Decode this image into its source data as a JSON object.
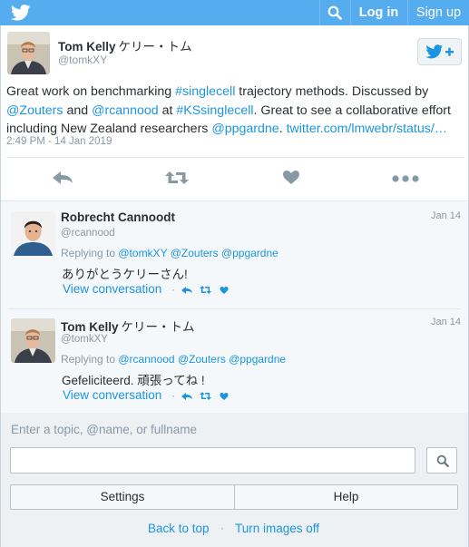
{
  "colors": {
    "brand": "#55acee",
    "link": "#1b95e0",
    "muted": "#8899a6",
    "text": "#292f33",
    "reply_bg": "#f5f8fa",
    "search_bg": "#eef1f4"
  },
  "header": {
    "logo_icon": "twitter-bird-icon",
    "search_icon": "search-icon",
    "login_label": "Log in",
    "signup_label": "Sign up"
  },
  "tweet": {
    "author_name": "Tom Kelly",
    "author_name_jp": "ケリー・トム",
    "author_handle": "@tomkXY",
    "follow_icon": "follow-bird-plus-icon",
    "text_segments": [
      {
        "t": "Great work on benchmarking ",
        "link": false
      },
      {
        "t": "#singlecell",
        "link": true
      },
      {
        "t": " trajectory methods. Discussed by ",
        "link": false
      },
      {
        "t": "@Zouters",
        "link": true
      },
      {
        "t": " and ",
        "link": false
      },
      {
        "t": "@rcannood",
        "link": true
      },
      {
        "t": " at ",
        "link": false
      },
      {
        "t": "#KSsinglecell",
        "link": true
      },
      {
        "t": ". Great to see a collaborative effort including New Zealand researchers ",
        "link": false
      },
      {
        "t": "@ppgardne",
        "link": true
      },
      {
        "t": ". ",
        "link": false
      },
      {
        "t": "twitter.com/lmwebr/status/…",
        "link": true
      }
    ],
    "timestamp": "2:49 PM - 14 Jan 2019",
    "actions": [
      "reply-icon",
      "retweet-icon",
      "like-icon",
      "more-icon"
    ]
  },
  "replies": [
    {
      "author_name": "Robrecht Cannoodt",
      "author_name_jp": "",
      "author_handle": "@rcannood",
      "date": "Jan 14",
      "replying_prefix": "Replying to ",
      "replying_to": [
        "@tomkXY",
        "@Zouters",
        "@ppgardne"
      ],
      "text": "ありがとうケリーさん!",
      "view_conversation": "View conversation"
    },
    {
      "author_name": "Tom Kelly",
      "author_name_jp": "ケリー・トム",
      "author_handle": "@tomkXY",
      "date": "Jan 14",
      "replying_prefix": "Replying to ",
      "replying_to": [
        "@rcannood",
        "@Zouters",
        "@ppgardne"
      ],
      "text": "Gefeliciteerd. 頑張ってね !",
      "view_conversation": "View conversation"
    }
  ],
  "search": {
    "hint": "Enter a topic, @name, or fullname",
    "value": "",
    "go_icon": "search-icon"
  },
  "footer": {
    "settings_label": "Settings",
    "help_label": "Help",
    "back_to_top": "Back to top",
    "turn_images_off": "Turn images off",
    "separator": "·"
  }
}
